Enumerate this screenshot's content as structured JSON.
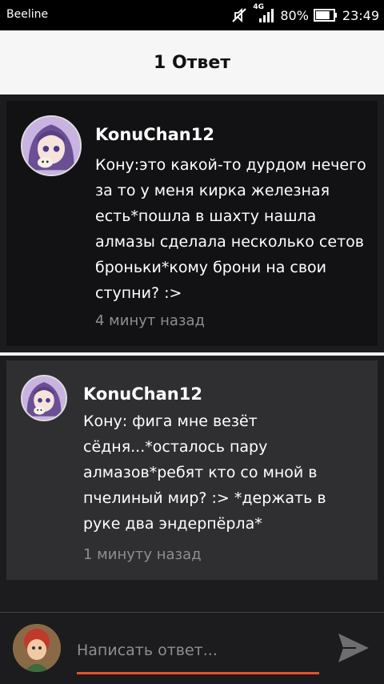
{
  "status_bar": {
    "carrier": "Beeline",
    "network": "4G",
    "battery": "80%",
    "battery_level": 0.8,
    "time": "23:49"
  },
  "header": {
    "title": "1 Ответ"
  },
  "comments": [
    {
      "author": "KonuChan12",
      "text": "Кону:это какой-то дурдом нечего за то у меня кирка железная есть*пошла в шахту нашла алмазы сделала несколько сетов броньки*кому брони на свои ступни? :>",
      "time": "4 минут назад"
    },
    {
      "author": "KonuChan12",
      "text": "Кону: фига мне везёт сёдня...*осталось пару алмазов*ребят кто со мной в пчелиный мир? :> *держать в руке два эндерпёрла*",
      "time": "1 минуту назад"
    }
  ],
  "reply": {
    "placeholder": "Написать ответ...",
    "accent": "#e8512a"
  }
}
